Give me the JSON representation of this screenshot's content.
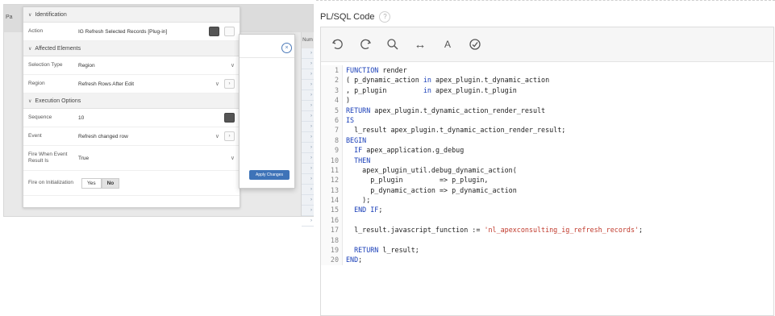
{
  "background_grid": {
    "left_label": "Pa",
    "column_header": "Num"
  },
  "properties_panel": {
    "identification": {
      "header": "Identification",
      "rows": [
        {
          "label": "Action",
          "value": "IG Refresh Selected Records [Plug-in]"
        }
      ]
    },
    "affected_elements": {
      "header": "Affected Elements",
      "rows": [
        {
          "label": "Selection Type",
          "value": "Region"
        },
        {
          "label": "Region",
          "value": "Refresh Rows After Edit"
        }
      ]
    },
    "execution_options": {
      "header": "Execution Options",
      "rows": [
        {
          "label": "Sequence",
          "value": "10"
        },
        {
          "label": "Event",
          "value": "Refresh changed row"
        },
        {
          "label": "Fire When Event Result Is",
          "value": "True"
        },
        {
          "label": "Fire on Initialization",
          "options": [
            "Yes",
            "No"
          ],
          "selected": "No"
        }
      ]
    }
  },
  "dialog": {
    "close_glyph": "×",
    "apply_button": "Apply Changes"
  },
  "editor": {
    "title": "PL/SQL Code",
    "help_glyph": "?",
    "toolbar": {
      "undo_icon": "undo-icon",
      "redo_icon": "redo-icon",
      "search_icon": "search-icon",
      "transform_label": "↔",
      "text_size_label": "A",
      "validate_icon": "validate-icon"
    },
    "lines": [
      {
        "n": "1",
        "segments": [
          {
            "t": "FUNCTION",
            "c": "kw"
          },
          {
            "t": " render",
            "c": ""
          }
        ]
      },
      {
        "n": "2",
        "segments": [
          {
            "t": "( p_dynamic_action ",
            "c": ""
          },
          {
            "t": "in",
            "c": "kw"
          },
          {
            "t": " apex_plugin.t_dynamic_action",
            "c": ""
          }
        ]
      },
      {
        "n": "3",
        "segments": [
          {
            "t": ", p_plugin         ",
            "c": ""
          },
          {
            "t": "in",
            "c": "kw"
          },
          {
            "t": " apex_plugin.t_plugin",
            "c": ""
          }
        ]
      },
      {
        "n": "4",
        "segments": [
          {
            "t": ")",
            "c": ""
          }
        ]
      },
      {
        "n": "5",
        "segments": [
          {
            "t": "RETURN",
            "c": "kw"
          },
          {
            "t": " apex_plugin.t_dynamic_action_render_result",
            "c": ""
          }
        ]
      },
      {
        "n": "6",
        "segments": [
          {
            "t": "IS",
            "c": "kw"
          }
        ]
      },
      {
        "n": "7",
        "segments": [
          {
            "t": "  l_result apex_plugin.t_dynamic_action_render_result;",
            "c": ""
          }
        ]
      },
      {
        "n": "8",
        "segments": [
          {
            "t": "BEGIN",
            "c": "kw"
          }
        ]
      },
      {
        "n": "9",
        "segments": [
          {
            "t": "  ",
            "c": ""
          },
          {
            "t": "IF",
            "c": "kw"
          },
          {
            "t": " apex_application.g_debug",
            "c": ""
          }
        ]
      },
      {
        "n": "10",
        "segments": [
          {
            "t": "  ",
            "c": ""
          },
          {
            "t": "THEN",
            "c": "kw"
          }
        ]
      },
      {
        "n": "11",
        "segments": [
          {
            "t": "    apex_plugin_util.debug_dynamic_action(",
            "c": ""
          }
        ]
      },
      {
        "n": "12",
        "segments": [
          {
            "t": "      p_plugin         => p_plugin,",
            "c": ""
          }
        ]
      },
      {
        "n": "13",
        "segments": [
          {
            "t": "      p_dynamic_action => p_dynamic_action",
            "c": ""
          }
        ]
      },
      {
        "n": "14",
        "segments": [
          {
            "t": "    );",
            "c": ""
          }
        ]
      },
      {
        "n": "15",
        "segments": [
          {
            "t": "  ",
            "c": ""
          },
          {
            "t": "END IF",
            "c": "kw"
          },
          {
            "t": ";",
            "c": ""
          }
        ]
      },
      {
        "n": "16",
        "segments": [
          {
            "t": "",
            "c": ""
          }
        ]
      },
      {
        "n": "17",
        "segments": [
          {
            "t": "  l_result.javascript_function := ",
            "c": ""
          },
          {
            "t": "'nl_apexconsulting_ig_refresh_records'",
            "c": "st"
          },
          {
            "t": ";",
            "c": ""
          }
        ]
      },
      {
        "n": "18",
        "segments": [
          {
            "t": "",
            "c": ""
          }
        ]
      },
      {
        "n": "19",
        "segments": [
          {
            "t": "  ",
            "c": ""
          },
          {
            "t": "RETURN",
            "c": "kw"
          },
          {
            "t": " l_result;",
            "c": ""
          }
        ]
      },
      {
        "n": "20",
        "segments": [
          {
            "t": "END",
            "c": "kw"
          },
          {
            "t": ";",
            "c": ""
          }
        ]
      }
    ]
  },
  "colors": {
    "keyword": "#1a3fb8",
    "string": "#c0392b",
    "accent": "#3e73b8"
  }
}
